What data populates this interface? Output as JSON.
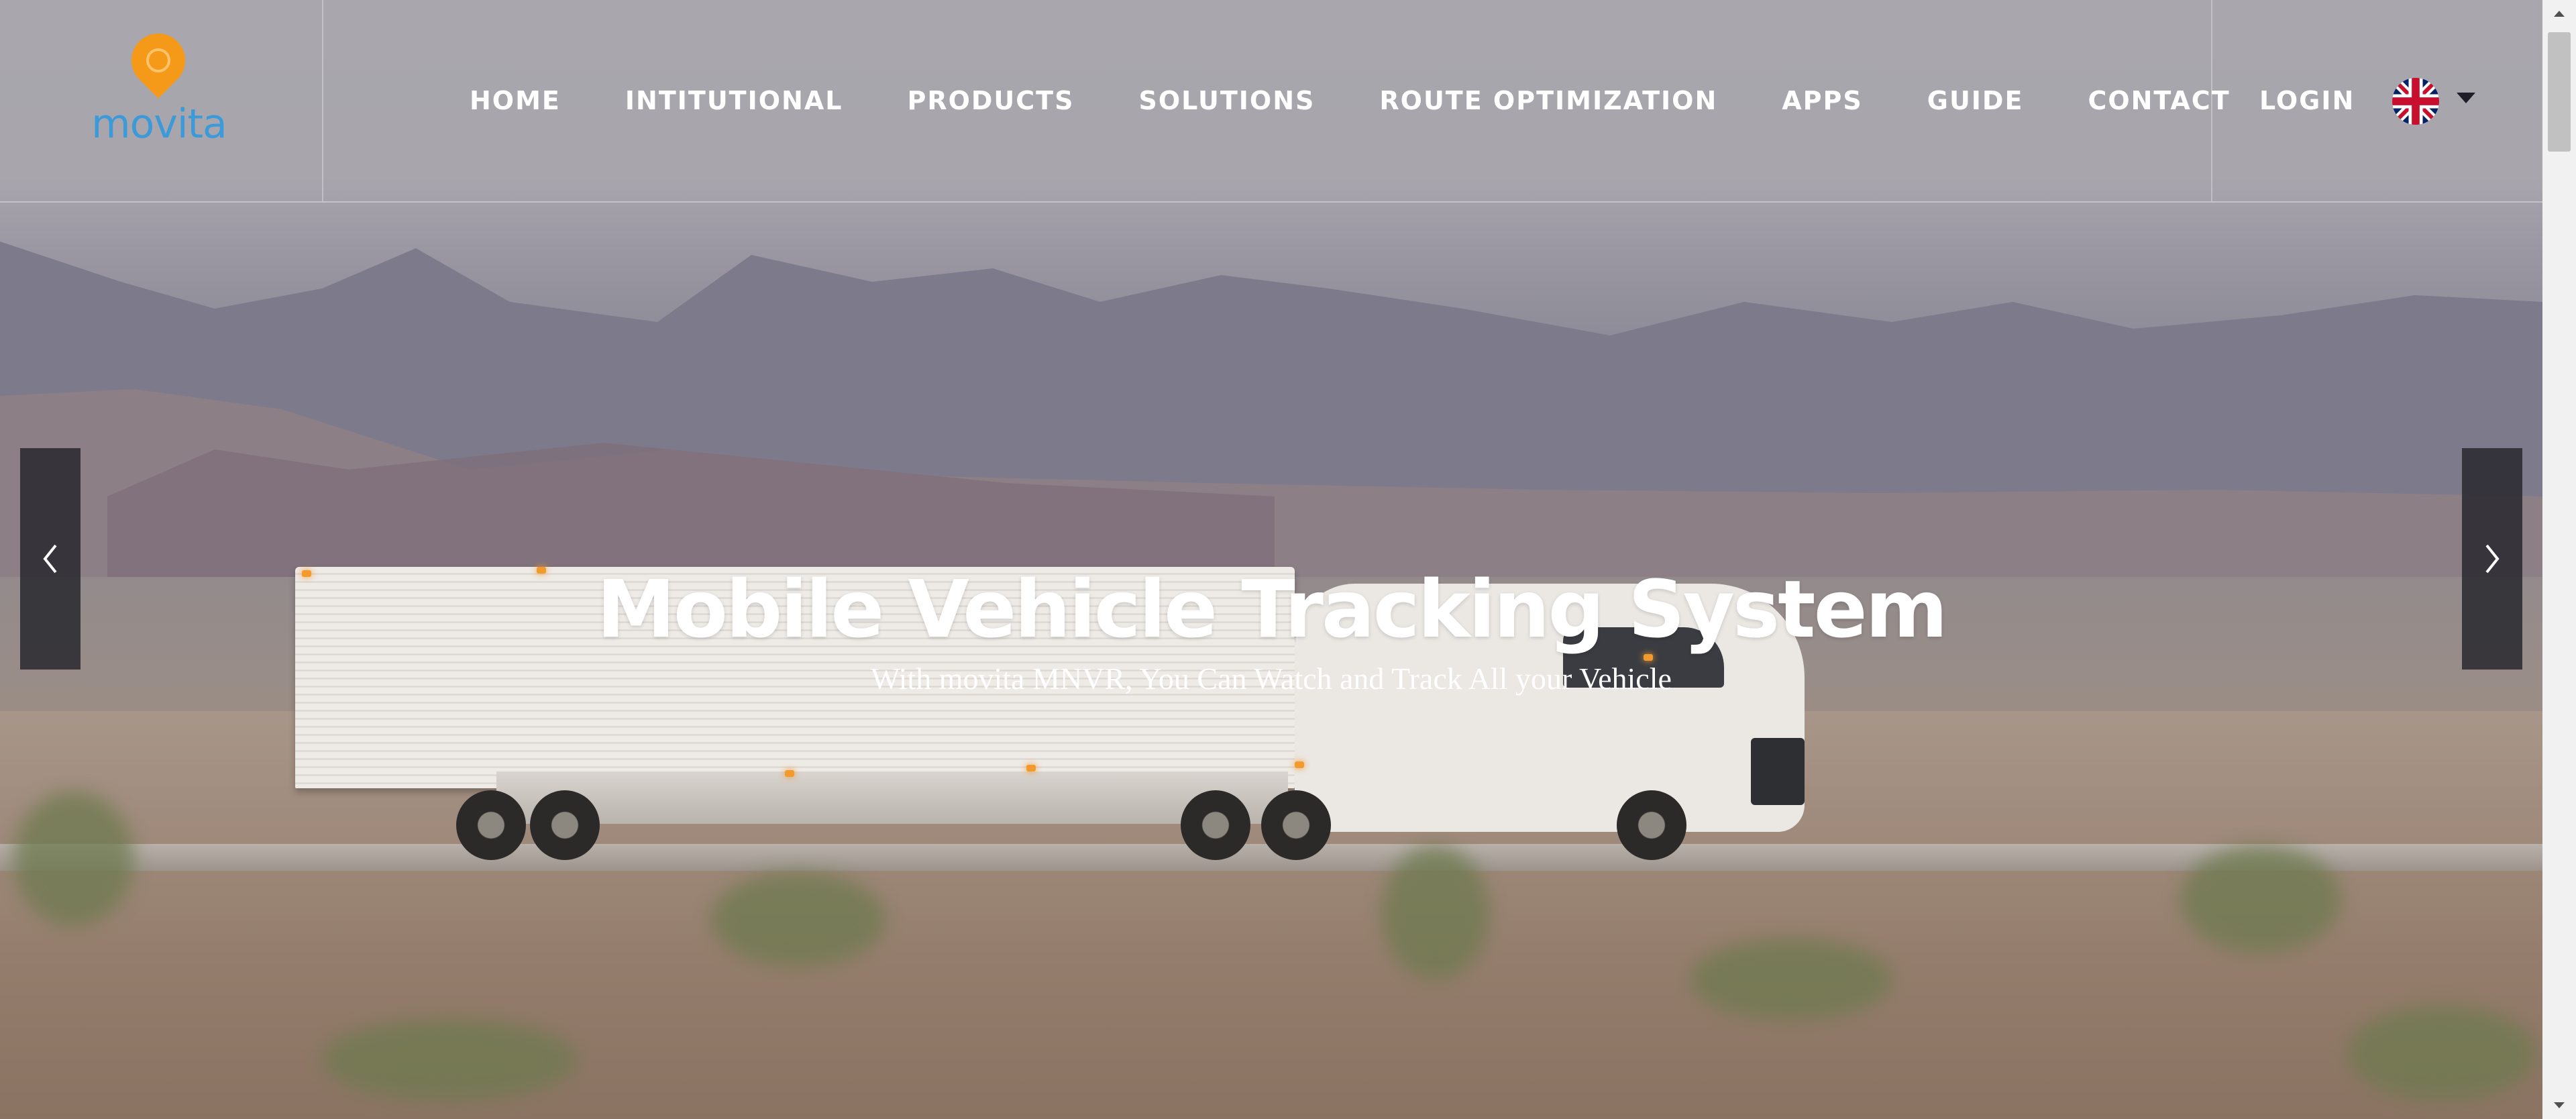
{
  "brand": {
    "logo_text": "movita",
    "logo_color": "#3d9ad9",
    "pin_color": "#f59a18"
  },
  "nav": {
    "items": [
      {
        "label": "HOME"
      },
      {
        "label": "INTITUTIONAL"
      },
      {
        "label": "PRODUCTS"
      },
      {
        "label": "SOLUTIONS"
      },
      {
        "label": "ROUTE OPTIMIZATION"
      },
      {
        "label": "APPS"
      },
      {
        "label": "GUIDE"
      },
      {
        "label": "CONTACT"
      }
    ],
    "login_label": "LOGIN",
    "language_icon": "uk-flag-icon"
  },
  "hero": {
    "title": "Mobile Vehicle Tracking System",
    "subtitle": "With movita MNVR, You Can Watch and Track All your Vehicle",
    "prev_icon": "chevron-left-icon",
    "next_icon": "chevron-right-icon"
  }
}
